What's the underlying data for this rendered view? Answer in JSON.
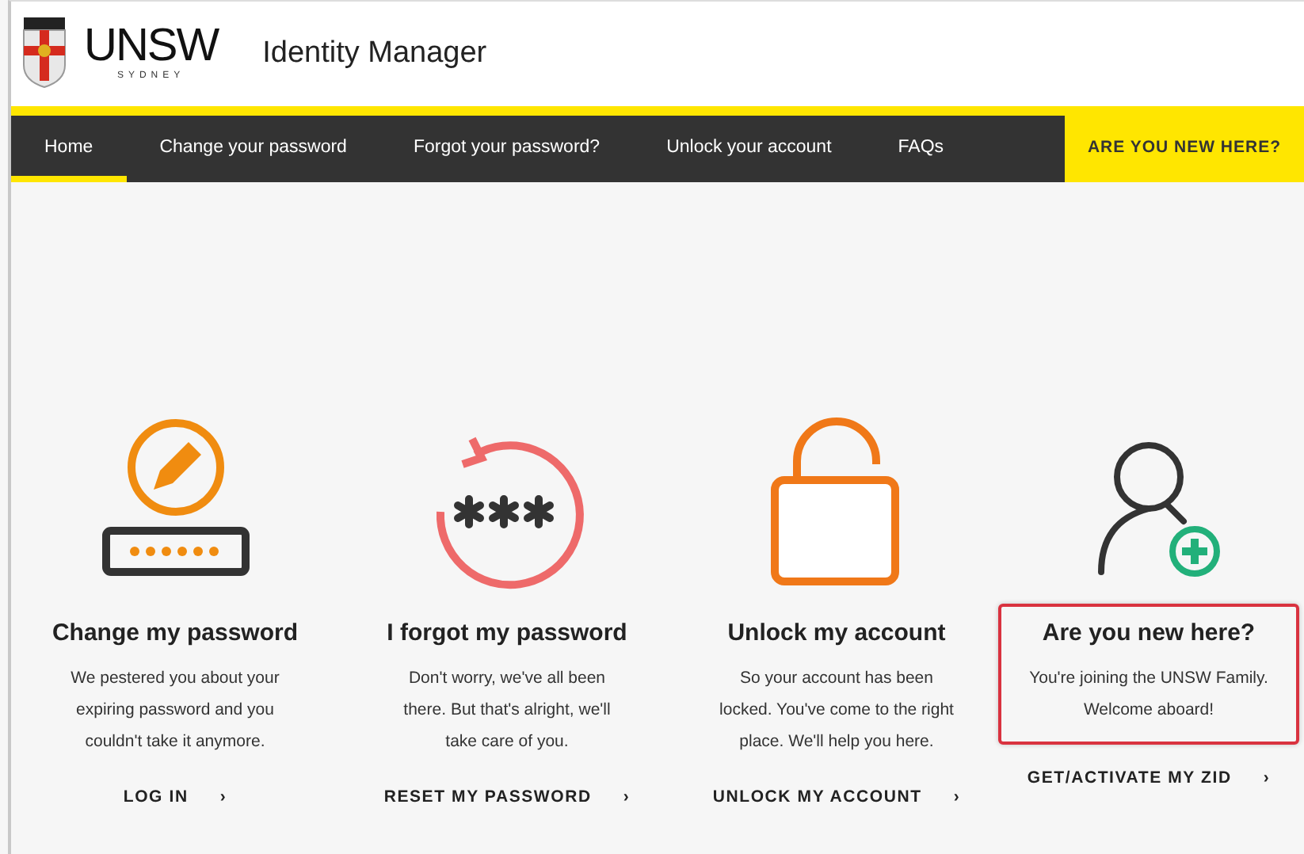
{
  "header": {
    "logo_word": "UNSW",
    "logo_sub": "SYDNEY",
    "title": "Identity Manager"
  },
  "nav": {
    "items": [
      {
        "label": "Home",
        "selected": true
      },
      {
        "label": "Change your password",
        "selected": false
      },
      {
        "label": "Forgot your password?",
        "selected": false
      },
      {
        "label": "Unlock your account",
        "selected": false
      },
      {
        "label": "FAQs",
        "selected": false
      }
    ],
    "cta": "ARE YOU NEW HERE?"
  },
  "cards": [
    {
      "kind": "change",
      "title": "Change my password",
      "text": "We pestered you about your expiring password and you couldn't take it anymore.",
      "link": "LOG IN",
      "chevron": "›",
      "highlighted": false
    },
    {
      "kind": "forgot",
      "title": "I forgot my password",
      "text": "Don't worry, we've all been there. But that's alright, we'll take care of you.",
      "link": "RESET MY PASSWORD",
      "chevron": "›",
      "highlighted": false
    },
    {
      "kind": "unlock",
      "title": "Unlock my account",
      "text": "So your account has been locked. You've come to the right place. We'll help you here.",
      "link": "UNLOCK MY ACCOUNT",
      "chevron": "›",
      "highlighted": false
    },
    {
      "kind": "new",
      "title": "Are you new here?",
      "text": "You're joining the UNSW Family. Welcome aboard!",
      "link": "GET/ACTIVATE MY ZID",
      "chevron": "›",
      "highlighted": true
    }
  ]
}
